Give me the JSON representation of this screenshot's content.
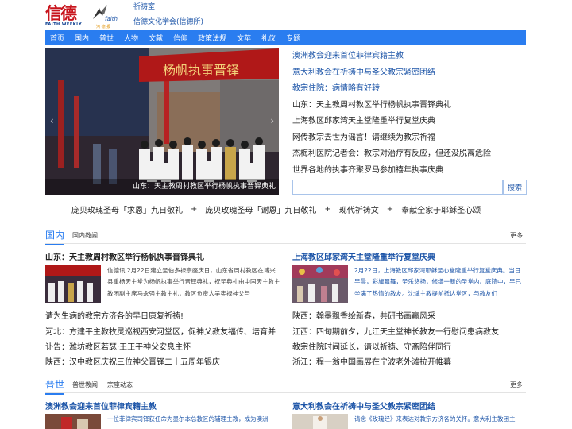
{
  "header": {
    "logo_cn": "信德",
    "logo_en": "FAITH WEEKLY",
    "logo2_text": "faith",
    "logo2_sub": "河 德 报",
    "links": [
      "祈祷室",
      "信德文化学会(信德所)"
    ]
  },
  "nav": [
    "首页",
    "国内",
    "普世",
    "人物",
    "文献",
    "信仰",
    "政策法规",
    "文苹",
    "礼仪",
    "专题"
  ],
  "hero": {
    "caption": "山东：天主教周村教区举行杨帆执事晋铎典礼",
    "banner_text": "杨帆执事晋铎"
  },
  "headlines": [
    {
      "text": "澳洲教会迎来首位菲律宾籍主教",
      "color": "blue"
    },
    {
      "text": "意大利教会在祈祷中与圣父教宗紧密团结",
      "color": "blue"
    },
    {
      "text": "教宗住院：病情略有好转",
      "color": "blue"
    },
    {
      "text": "山东：天主教周村教区举行杨帆执事晋铎典礼",
      "color": "dark"
    },
    {
      "text": "上海教区邱家湾天主堂隆重举行复堂庆典",
      "color": "dark"
    },
    {
      "text": "网传教宗去世为谣言！请继续为教宗祈福",
      "color": "dark"
    },
    {
      "text": "杰梅利医院记者会：教宗对治疗有反应，但还没脱离危险",
      "color": "dark"
    },
    {
      "text": "世界各地的执事齐聚罗马参加禧年执事庆典",
      "color": "dark"
    }
  ],
  "search": {
    "placeholder": "",
    "button": "搜索"
  },
  "prayers": {
    "items": [
      "庞贝玫瑰圣母「求恩」九日敬礼",
      "庞贝玫瑰圣母「谢恩」九日敬礼",
      "现代祈祷文",
      "奉献全家于耶稣圣心颂"
    ],
    "sep": "+"
  },
  "domestic": {
    "title": "国内",
    "tab": "国内教闻",
    "more": "更多",
    "left": {
      "title": "山东：天主教周村教区举行杨帆执事晋铎典礼",
      "summary": "信德讯 2月22日建立圣伯多禄宗座庆日，山东省周村教区在博兴县重杨天主堂为杨帆执事举行晋铎典礼，祝圣典礼由中国天主教主教团副主席马永强主教主礼，教区负责人吴宪禄神父与",
      "summary_tail": "请为生病的教宗方济各的早日康复祈祷!",
      "items": [
        "河北：方建平主教牧灵巡视西安河堂区，促神父教友福传、培育并",
        "讣告：潍坊教区若瑟·王正平神父安息主怀",
        "陕西：汉中教区庆祝三位神父晋铎二十五周年银庆"
      ]
    },
    "right": {
      "title": "上海教区邱家湾天主堂隆重举行复堂庆典",
      "summary": "2月22日，上海教区邱家湾耶稣圣心堂隆重举行复堂庆典。当日早晨，彩旗飘舞，圣乐悠扬，修缮一新的圣堂内、庭院中，早已坐满了热情的教友。沈斌主教提前抵达堂区，与教友们",
      "items": [
        "陕西：翰墨飘香绘新春，共研书画赢风采",
        "江西：四旬期前夕，九江天主堂神长教友一行慰问患病教友",
        "教宗住院时间延长，请以祈祷、守斋陪伴同行",
        "浙江：程一翁中国画展在宁波老外滩拉开帷幕"
      ]
    }
  },
  "world": {
    "title": "普世",
    "tabs": [
      "普世教闻",
      "宗座动态"
    ],
    "more": "更多",
    "left": {
      "title": "澳洲教会迎来首位菲律宾籍主教",
      "summary": "一位菲律宾司铎获任命为墨尔本总教区的辅理主教，成为澳洲"
    },
    "right": {
      "title": "意大利教会在祈祷中与圣父教宗紧密团结",
      "summary": "请念《玫瑰经》来表达对教宗方济各的关怀。意大利主教团主"
    }
  },
  "colors": {
    "accent": "#2a7df0",
    "link": "#1d55a8",
    "logo_red": "#c8141c"
  }
}
